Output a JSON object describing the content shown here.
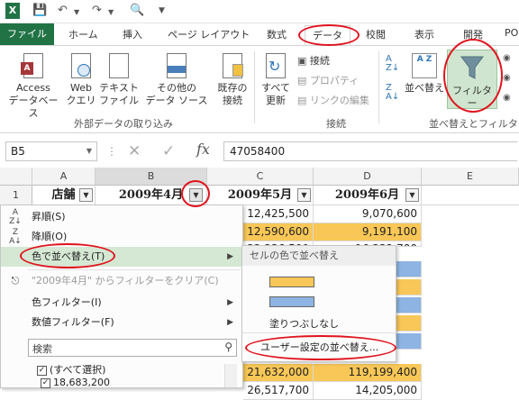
{
  "titlebar": {
    "app_icon": "X",
    "save_icon": "save-icon",
    "undo_icon": "undo-icon",
    "redo_icon": "redo-icon",
    "preview_icon": "print-preview-icon"
  },
  "tabs": {
    "file": "ファイル",
    "items": [
      "ホーム",
      "挿入",
      "ページ レイアウト",
      "数式",
      "データ",
      "校閲",
      "表示",
      "開発",
      "PO"
    ],
    "active": "データ"
  },
  "ribbon": {
    "access": [
      "Access",
      "データベース"
    ],
    "web": [
      "Web",
      "クエリ"
    ],
    "text": [
      "テキスト",
      "ファイル"
    ],
    "other": [
      "その他の",
      "データ ソース"
    ],
    "existing": [
      "既存の",
      "接続"
    ],
    "group_external": "外部データの取り込み",
    "refresh": [
      "すべて",
      "更新"
    ],
    "connections": "接続",
    "properties": "プロパティ",
    "edit_links": "リンクの編集",
    "group_connections": "接続",
    "sort_az": "A Z",
    "sort_label": "並べ替え",
    "filter_label": "フィルター",
    "group_sort_filter": "並べ替えとフィルター"
  },
  "formula_bar": {
    "name_box": "B5",
    "fx": "fx",
    "value": "47058400"
  },
  "grid": {
    "columns": [
      "A",
      "B",
      "C",
      "D",
      "E"
    ],
    "row1": {
      "rownum": "1",
      "a": "店舗",
      "b": "2009年4月",
      "c": "2009年5月",
      "d": "2009年6月"
    },
    "c_values": [
      "12,425,500",
      "12,590,600",
      "22,236,500",
      "21,632,000",
      "26,517,700"
    ],
    "d_values": [
      "9,070,600",
      "9,191,100",
      "16,232,700",
      "119,199,400",
      "14,205,000"
    ],
    "colors": {
      "orange": "#f8c757",
      "blue": "#8db4e2"
    }
  },
  "menu": {
    "sort_asc": "昇順(S)",
    "sort_desc": "降順(O)",
    "sort_color": "色で並べ替え(T)",
    "clear_filter": "\"2009年4月\" からフィルターをクリア(C)",
    "color_filter": "色フィルター(I)",
    "number_filter": "数値フィルター(F)",
    "search_placeholder": "検索",
    "select_all": "(すべて選択)",
    "first_value": "18,683,200"
  },
  "submenu": {
    "title": "セルの色で並べ替え",
    "no_fill": "塗りつぶしなし",
    "custom_sort": "ユーザー設定の並べ替え..."
  }
}
